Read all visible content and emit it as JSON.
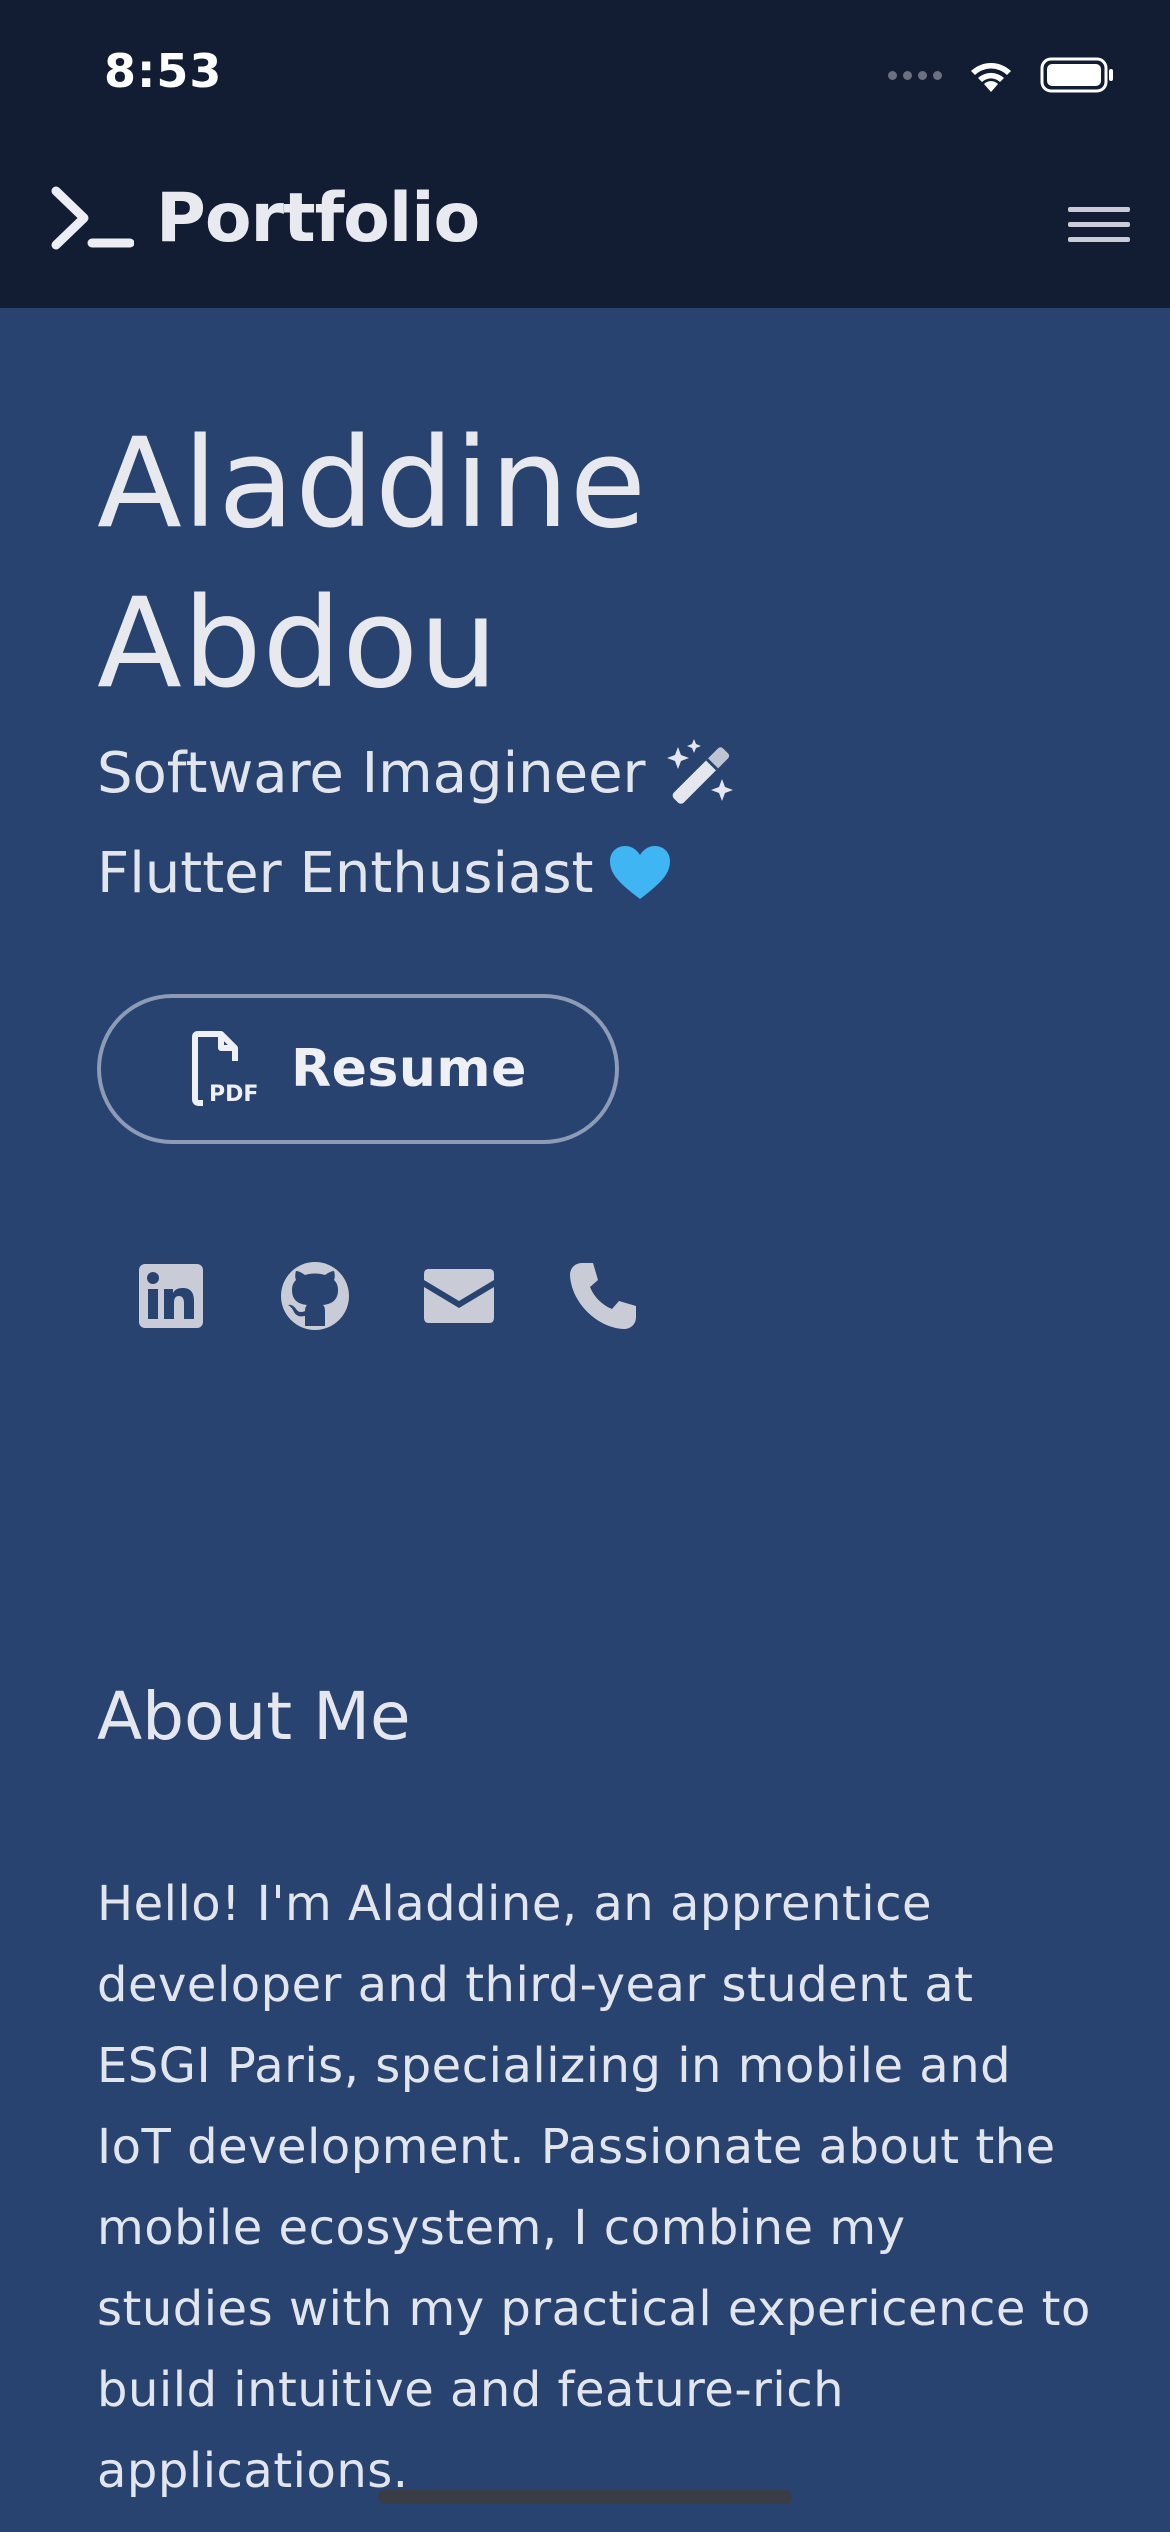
{
  "status_bar": {
    "time": "8:53"
  },
  "header": {
    "brand_icon": "terminal-prompt-icon",
    "title": "Portfolio",
    "menu_icon": "hamburger-menu-icon"
  },
  "hero": {
    "name_line1": "Aladdine",
    "name_line2": "Abdou",
    "tagline1": "Software Imagineer",
    "tagline1_icon": "magic-wand-icon",
    "tagline2": "Flutter Enthusiast",
    "tagline2_icon": "blue-heart-icon",
    "resume_label": "Resume",
    "resume_icon": "pdf-file-icon"
  },
  "socials": [
    {
      "icon": "linkedin-icon"
    },
    {
      "icon": "github-icon"
    },
    {
      "icon": "email-icon"
    },
    {
      "icon": "phone-icon"
    }
  ],
  "about": {
    "title": "About Me",
    "body": "Hello! I'm Aladdine, an apprentice developer and third-year student at ESGI Paris, specializing in mobile and IoT development. Passionate about the mobile ecosystem, I combine my studies with my practical expericence to build intuitive and feature-rich applications."
  },
  "colors": {
    "background": "#28436f",
    "topbar": "#121d33",
    "heart": "#3fb6f3",
    "text": "#e6e7ee"
  }
}
